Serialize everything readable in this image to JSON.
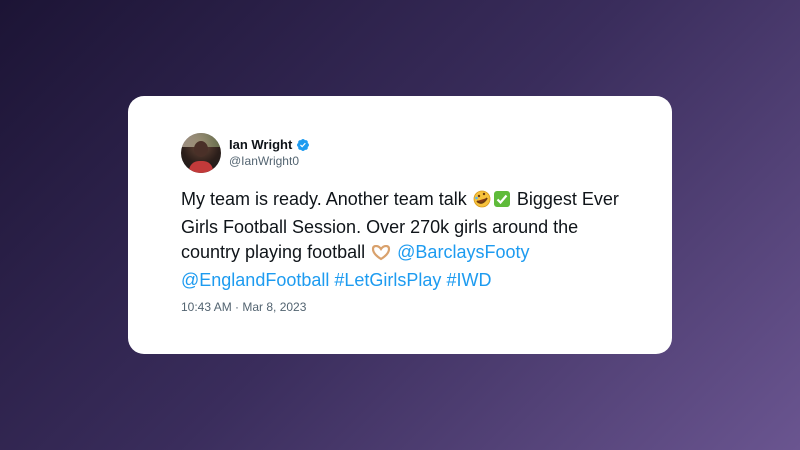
{
  "tweet": {
    "author": {
      "name": "Ian Wright",
      "handle": "@IanWright0",
      "verified": true
    },
    "text": {
      "part1": "My team is ready. Another team talk",
      "part2": "Biggest Ever Girls Football Session. Over 270k girls around the country playing football",
      "mention1": "@BarclaysFooty",
      "mention2": "@EnglandFootball",
      "hashtag1": "#LetGirlsPlay",
      "hashtag2": "#IWD",
      "emoji1": "rolling-on-floor-laughing-emoji",
      "emoji2": "check-mark-button-emoji",
      "emoji3": "heart-hands-emoji"
    },
    "timestamp": "10:43 AM · Mar 8, 2023"
  },
  "colors": {
    "link": "#1d9bf0",
    "verified": "#1d9bf0",
    "text": "#0f1419",
    "muted": "#536471"
  }
}
